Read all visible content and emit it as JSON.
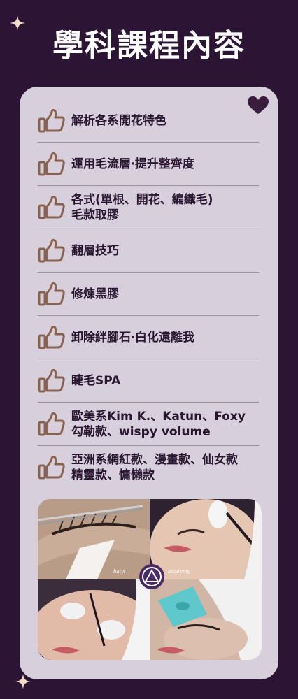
{
  "header": {
    "title": "學科課程內容"
  },
  "colors": {
    "background": "#2c1434",
    "card": "#d7d0dc",
    "icon": "#8a6250",
    "text": "#2a1631",
    "heart": "#3a1d3c",
    "sparkle": "#f2dcc8"
  },
  "items": [
    {
      "lines": [
        "解析各系開花特色"
      ]
    },
    {
      "lines": [
        "運用毛流層‧提升整齊度"
      ]
    },
    {
      "lines": [
        "各式(單根、開花、編織毛)",
        "毛款取膠"
      ]
    },
    {
      "lines": [
        "翻層技巧"
      ]
    },
    {
      "lines": [
        "修煉黑膠"
      ]
    },
    {
      "lines": [
        "卸除絆腳石‧白化遠離我"
      ]
    },
    {
      "lines": [
        "睫毛SPA"
      ]
    },
    {
      "lines": [
        "歐美系Kim K.、Katun、Foxy",
        "勾勒款、wispy volume"
      ]
    },
    {
      "lines": [
        "亞洲系網紅款、漫畫款、仙女款",
        "精靈款、慵懶款"
      ]
    }
  ],
  "logo": {
    "left_text": "haiyi",
    "right_text": "academy"
  },
  "icons": {
    "item": "thumbs-up-icon",
    "corner": "heart-icon",
    "decor": "sparkle-icon"
  }
}
